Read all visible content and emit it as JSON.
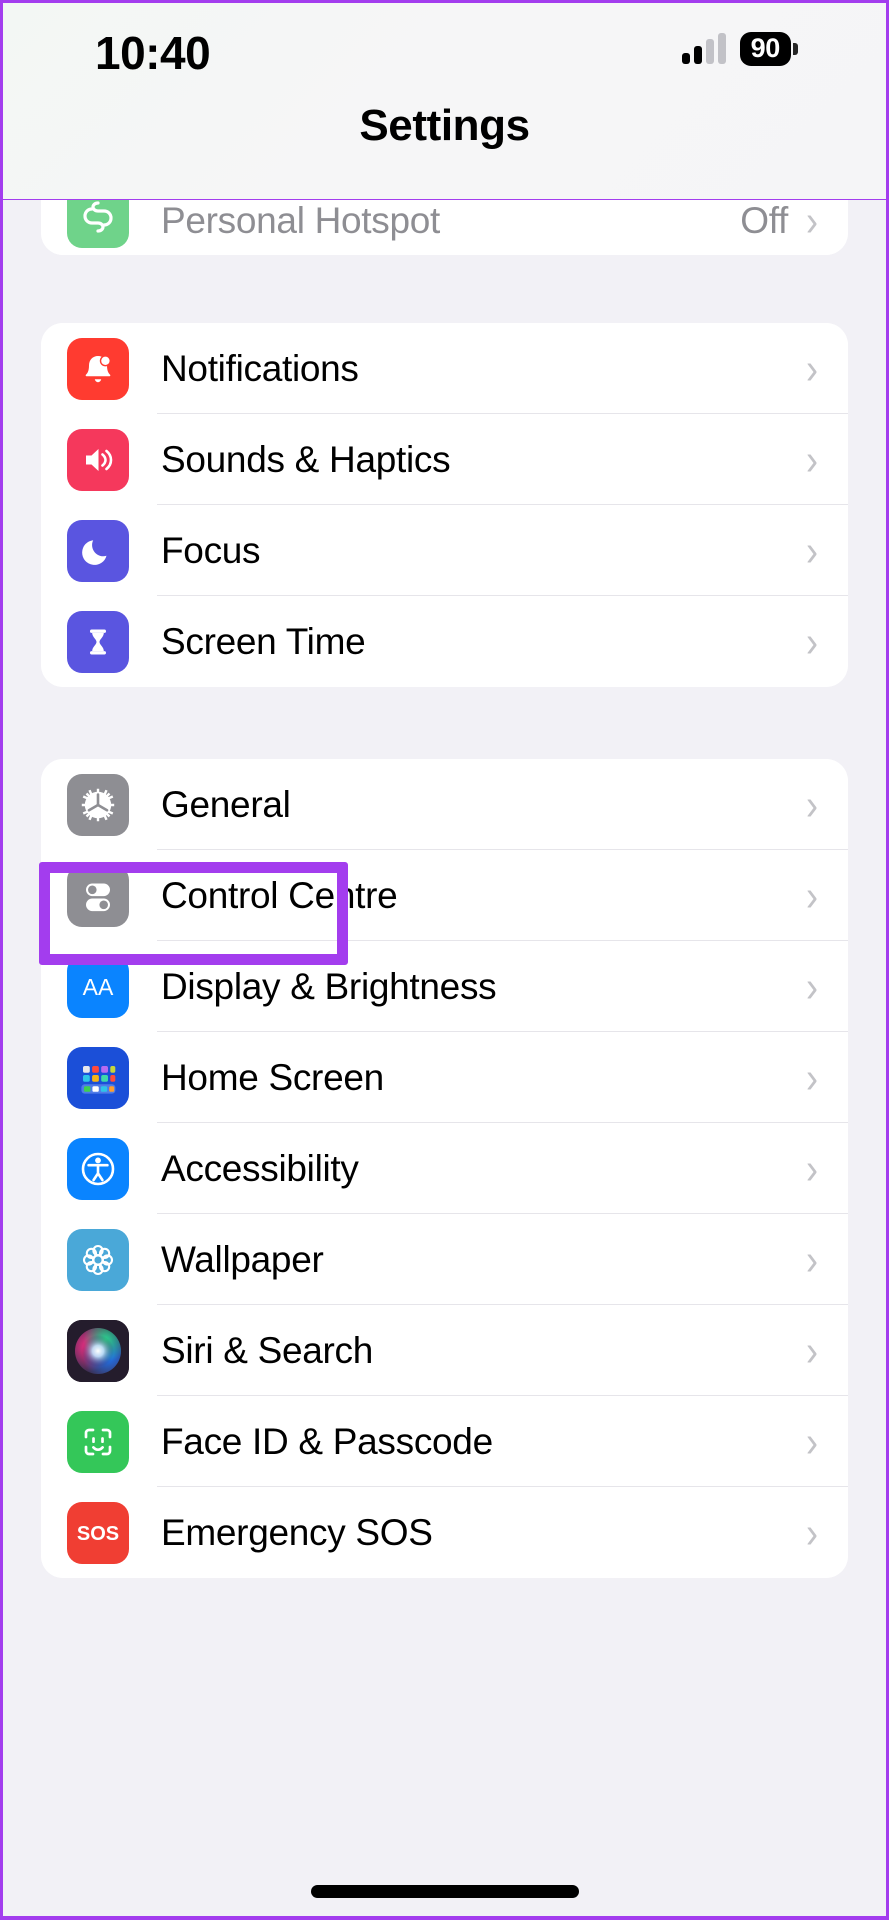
{
  "status_bar": {
    "time": "10:40",
    "battery_percent": "90",
    "signal_bars_filled": 2,
    "signal_bars_total": 4
  },
  "header": {
    "title": "Settings"
  },
  "colors": {
    "highlight": "#a33dee",
    "page_background": "#f2f1f6",
    "row_background": "#ffffff",
    "chevron": "#c3c3c7",
    "secondary_text": "#8e8e93"
  },
  "groups": [
    {
      "name": "connectivity-group",
      "clipped": true,
      "rows": [
        {
          "label": "Personal Hotspot",
          "icon": "personal-hotspot-icon",
          "icon_color": "#6fd38a",
          "value": "Off",
          "chevron": "›",
          "dim": true
        }
      ]
    },
    {
      "name": "alerts-group",
      "clipped": false,
      "rows": [
        {
          "label": "Notifications",
          "icon": "notifications-bell-icon",
          "icon_color": "#ff3b30",
          "value": "",
          "chevron": "›"
        },
        {
          "label": "Sounds & Haptics",
          "icon": "sounds-speaker-icon",
          "icon_color": "#f5385c",
          "value": "",
          "chevron": "›"
        },
        {
          "label": "Focus",
          "icon": "focus-moon-icon",
          "icon_color": "#5a55e0",
          "value": "",
          "chevron": "›"
        },
        {
          "label": "Screen Time",
          "icon": "screen-time-hourglass-icon",
          "icon_color": "#5a55e0",
          "value": "",
          "chevron": "›"
        }
      ]
    },
    {
      "name": "system-group",
      "clipped": false,
      "rows": [
        {
          "label": "General",
          "icon": "general-gear-icon",
          "icon_color": "#8e8e93",
          "value": "",
          "chevron": "›",
          "highlighted": true
        },
        {
          "label": "Control Centre",
          "icon": "control-centre-toggles-icon",
          "icon_color": "#8e8e93",
          "value": "",
          "chevron": "›"
        },
        {
          "label": "Display & Brightness",
          "icon": "display-brightness-aa-icon",
          "icon_color": "#0a84ff",
          "value": "",
          "chevron": "›"
        },
        {
          "label": "Home Screen",
          "icon": "home-screen-grid-icon",
          "icon_color": "#1b4fd8",
          "value": "",
          "chevron": "›"
        },
        {
          "label": "Accessibility",
          "icon": "accessibility-person-icon",
          "icon_color": "#0a84ff",
          "value": "",
          "chevron": "›"
        },
        {
          "label": "Wallpaper",
          "icon": "wallpaper-flower-icon",
          "icon_color": "#4aa8d8",
          "value": "",
          "chevron": "›"
        },
        {
          "label": "Siri & Search",
          "icon": "siri-orb-icon",
          "icon_color": "#231f2e",
          "value": "",
          "chevron": "›"
        },
        {
          "label": "Face ID & Passcode",
          "icon": "face-id-icon",
          "icon_color": "#34c759",
          "value": "",
          "chevron": "›"
        },
        {
          "label": "Emergency SOS",
          "icon": "emergency-sos-icon",
          "icon_color": "#f03e33",
          "value": "",
          "chevron": "›"
        }
      ]
    }
  ]
}
